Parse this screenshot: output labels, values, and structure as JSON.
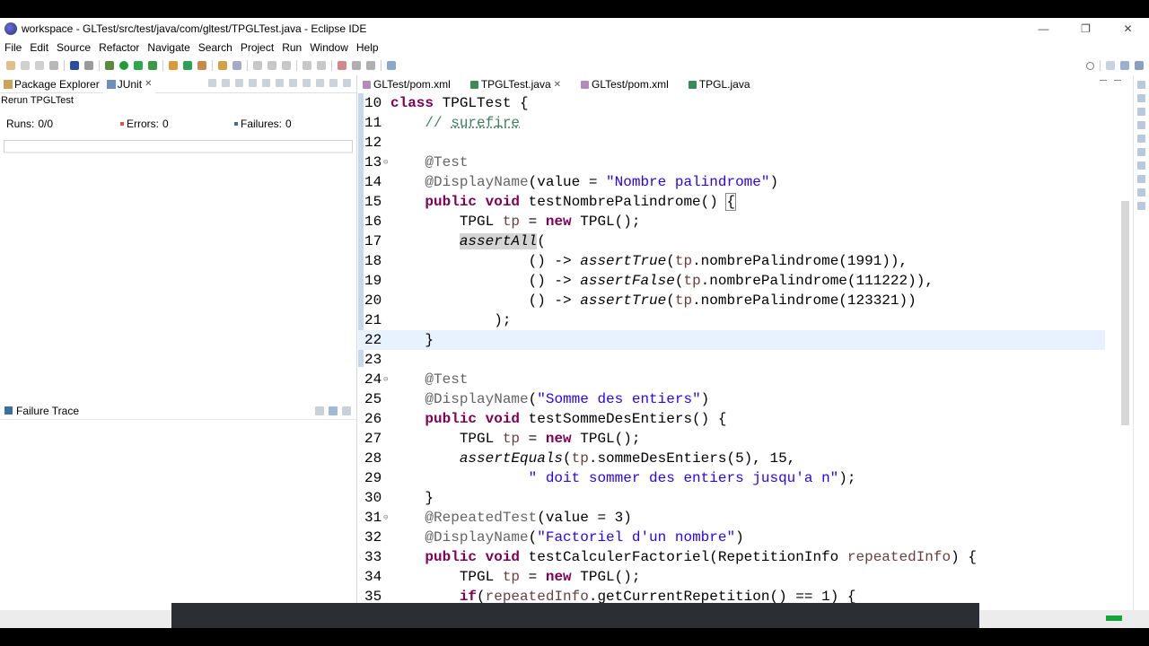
{
  "window": {
    "title": "workspace - GLTest/src/test/java/com/gltest/TPGLTest.java - Eclipse IDE",
    "minimize": "—",
    "restore": "❐",
    "close": "✕"
  },
  "menu": [
    "File",
    "Edit",
    "Source",
    "Refactor",
    "Navigate",
    "Search",
    "Project",
    "Run",
    "Window",
    "Help"
  ],
  "left_panel": {
    "tabs": [
      {
        "label": "Package Explorer",
        "active": false
      },
      {
        "label": "JUnit",
        "active": true,
        "close": "✕"
      }
    ],
    "rerun_label": "Rerun TPGLTest",
    "stats": [
      {
        "label": "Runs:",
        "value": "0/0"
      },
      {
        "label": "Errors:",
        "value": "0"
      },
      {
        "label": "Failures:",
        "value": "0"
      }
    ],
    "failure_trace_label": "Failure Trace"
  },
  "editor": {
    "tabs": [
      {
        "label": "GLTest/pom.xml",
        "active": false
      },
      {
        "label": "TPGLTest.java",
        "active": true,
        "close": "✕"
      },
      {
        "label": "GLTest/pom.xml",
        "active": false
      },
      {
        "label": "TPGL.java",
        "active": false
      }
    ],
    "current_line": 22,
    "lines": [
      {
        "n": "10",
        "tokens": [
          [
            "kw",
            "class "
          ],
          [
            "",
            "TPGLTest {"
          ]
        ]
      },
      {
        "n": "11",
        "tokens": [
          [
            "",
            "    "
          ],
          [
            "cmt",
            "// "
          ],
          [
            "cmt ul",
            "surefire"
          ]
        ]
      },
      {
        "n": "12",
        "tokens": [
          [
            "",
            ""
          ]
        ]
      },
      {
        "n": "13",
        "fold": "⊖",
        "tokens": [
          [
            "",
            "    "
          ],
          [
            "ann",
            "@Test"
          ]
        ]
      },
      {
        "n": "14",
        "tokens": [
          [
            "",
            "    "
          ],
          [
            "ann",
            "@DisplayName"
          ],
          [
            "",
            "(value = "
          ],
          [
            "str",
            "\"Nombre palindrome\""
          ],
          [
            "",
            ")"
          ]
        ]
      },
      {
        "n": "15",
        "tokens": [
          [
            "",
            "    "
          ],
          [
            "kw",
            "public void "
          ],
          [
            "",
            "testNombrePalindrome() "
          ],
          [
            "bracket",
            "{"
          ]
        ]
      },
      {
        "n": "16",
        "tokens": [
          [
            "",
            "        TPGL "
          ],
          [
            "local",
            "tp"
          ],
          [
            "",
            " = "
          ],
          [
            "kw",
            "new "
          ],
          [
            "",
            "TPGL();"
          ]
        ]
      },
      {
        "n": "17",
        "tokens": [
          [
            "",
            "        "
          ],
          [
            "it hl",
            "assertAll"
          ],
          [
            "",
            "("
          ]
        ]
      },
      {
        "n": "18",
        "tokens": [
          [
            "",
            "                () -> "
          ],
          [
            "it",
            "assertTrue"
          ],
          [
            "",
            "("
          ],
          [
            "local",
            "tp"
          ],
          [
            "",
            ".nombrePalindrome(1991)),"
          ]
        ]
      },
      {
        "n": "19",
        "tokens": [
          [
            "",
            "                () -> "
          ],
          [
            "it",
            "assertFalse"
          ],
          [
            "",
            "("
          ],
          [
            "local",
            "tp"
          ],
          [
            "",
            ".nombrePalindrome(111222)),"
          ]
        ]
      },
      {
        "n": "20",
        "tokens": [
          [
            "",
            "                () -> "
          ],
          [
            "it",
            "assertTrue"
          ],
          [
            "",
            "("
          ],
          [
            "local",
            "tp"
          ],
          [
            "",
            ".nombrePalindrome(123321))"
          ]
        ]
      },
      {
        "n": "21",
        "tokens": [
          [
            "",
            "            );"
          ]
        ]
      },
      {
        "n": "22",
        "tokens": [
          [
            "",
            "    }"
          ]
        ]
      },
      {
        "n": "23",
        "tokens": [
          [
            "",
            ""
          ]
        ]
      },
      {
        "n": "24",
        "fold": "⊖",
        "tokens": [
          [
            "",
            "    "
          ],
          [
            "ann",
            "@Test"
          ]
        ]
      },
      {
        "n": "25",
        "tokens": [
          [
            "",
            "    "
          ],
          [
            "ann",
            "@DisplayName"
          ],
          [
            "",
            "("
          ],
          [
            "str",
            "\"Somme des entiers\""
          ],
          [
            "",
            ")"
          ]
        ]
      },
      {
        "n": "26",
        "tokens": [
          [
            "",
            "    "
          ],
          [
            "kw",
            "public void "
          ],
          [
            "",
            "testSommeDesEntiers() {"
          ]
        ]
      },
      {
        "n": "27",
        "tokens": [
          [
            "",
            "        TPGL "
          ],
          [
            "local",
            "tp"
          ],
          [
            "",
            " = "
          ],
          [
            "kw",
            "new "
          ],
          [
            "",
            "TPGL();"
          ]
        ]
      },
      {
        "n": "28",
        "tokens": [
          [
            "",
            "        "
          ],
          [
            "it",
            "assertEquals"
          ],
          [
            "",
            "("
          ],
          [
            "local",
            "tp"
          ],
          [
            "",
            ".sommeDesEntiers(5), 15,"
          ]
        ]
      },
      {
        "n": "29",
        "tokens": [
          [
            "",
            "                "
          ],
          [
            "str",
            "\" doit sommer des entiers jusqu'a n\""
          ],
          [
            "",
            ");"
          ]
        ]
      },
      {
        "n": "30",
        "tokens": [
          [
            "",
            "    }"
          ]
        ]
      },
      {
        "n": "31",
        "fold": "⊖",
        "tokens": [
          [
            "",
            "    "
          ],
          [
            "ann",
            "@RepeatedTest"
          ],
          [
            "",
            "(value = 3)"
          ]
        ]
      },
      {
        "n": "32",
        "tokens": [
          [
            "",
            "    "
          ],
          [
            "ann",
            "@DisplayName"
          ],
          [
            "",
            "("
          ],
          [
            "str",
            "\"Factoriel d'un nombre\""
          ],
          [
            "",
            ")"
          ]
        ]
      },
      {
        "n": "33",
        "tokens": [
          [
            "",
            "    "
          ],
          [
            "kw",
            "public void "
          ],
          [
            "",
            "testCalculerFactoriel(RepetitionInfo "
          ],
          [
            "local",
            "repeatedInfo"
          ],
          [
            "",
            ") {"
          ]
        ]
      },
      {
        "n": "34",
        "tokens": [
          [
            "",
            "        TPGL "
          ],
          [
            "local",
            "tp"
          ],
          [
            "",
            " = "
          ],
          [
            "kw",
            "new "
          ],
          [
            "",
            "TPGL();"
          ]
        ]
      },
      {
        "n": "35",
        "tokens": [
          [
            "",
            "        "
          ],
          [
            "kw",
            "if"
          ],
          [
            "",
            "("
          ],
          [
            "local",
            "repeatedInfo"
          ],
          [
            "",
            ".getCurrentRepetition() == 1) {"
          ]
        ]
      }
    ]
  },
  "colors": {
    "keyword": "#7f0055",
    "comment": "#3f7f5f",
    "string": "#2a00ff",
    "annotation": "#646464",
    "current_line": "#e8f2fe",
    "status_ok": "#11a83a"
  }
}
